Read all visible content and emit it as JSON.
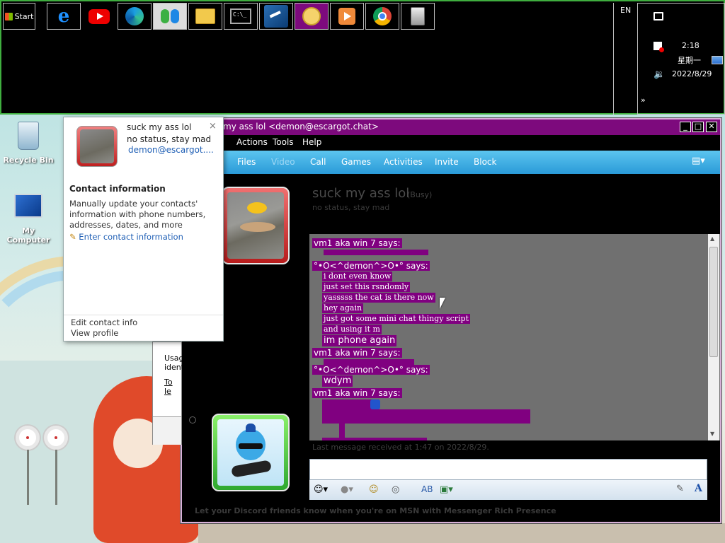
{
  "taskbar": {
    "start_label": "Start",
    "language": "EN",
    "clock": {
      "time": "2:18",
      "weekday": "星期一",
      "date": "2022/8/29"
    },
    "apps": [
      {
        "name": "internet-explorer-icon"
      },
      {
        "name": "youtube-icon"
      },
      {
        "name": "edge-icon"
      },
      {
        "name": "msn-messenger-icon"
      },
      {
        "name": "file-explorer-icon"
      },
      {
        "name": "command-prompt-icon"
      },
      {
        "name": "windows-live-mail-icon"
      },
      {
        "name": "bonzi-helper-icon"
      },
      {
        "name": "media-player-icon"
      },
      {
        "name": "chrome-icon"
      },
      {
        "name": "recycle-app-icon"
      }
    ]
  },
  "desktop": {
    "icons": [
      {
        "label": "Recycle Bin"
      },
      {
        "label": "My Computer"
      }
    ]
  },
  "messenger": {
    "title": "my ass lol <demon@escargot.chat>",
    "menu": [
      "Actions",
      "Tools",
      "Help"
    ],
    "toolbar": [
      "Files",
      "Video",
      "Call",
      "Games",
      "Activities",
      "Invite",
      "Block"
    ],
    "contact_name": "suck my ass lol",
    "contact_status": "(Busy)",
    "contact_message": "no status, stay mad",
    "messages": [
      {
        "text": "vm1 aka win 7 says:",
        "style": "sender"
      },
      {
        "text": "°•O<^demon^>O•° says:",
        "style": "sender"
      },
      {
        "text": "i dont even know",
        "style": "serif"
      },
      {
        "text": "just set this rsndomly",
        "style": "serif"
      },
      {
        "text": "yasssss the cat is there now",
        "style": "serif"
      },
      {
        "text": "hey again",
        "style": "serif"
      },
      {
        "text": "just got some mini chat thingy script",
        "style": "serif"
      },
      {
        "text": "and using it m",
        "style": "serif"
      },
      {
        "text": "im phone again",
        "style": "big"
      },
      {
        "text": "vm1 aka win 7 says:",
        "style": "sender"
      },
      {
        "text": "°•O<^demon^>O•° says:",
        "style": "sender"
      },
      {
        "text": "wdym",
        "style": "big"
      },
      {
        "text": "vm1 aka win 7 says:",
        "style": "sender"
      }
    ],
    "last_message": "Last message received at 1:47 on 2022/8/29.",
    "ad_text": "Let your Discord friends know when you're on MSN with Messenger Rich Presence",
    "colors": {
      "title": "#7d0a7d",
      "message_bg": "#800080",
      "toolbar": "#2a9ad8"
    }
  },
  "contact_card": {
    "name": "suck my ass lol",
    "status": "no status, stay mad",
    "email": "demon@escargot....",
    "section_title": "Contact information",
    "description": "Manually update your contacts' information with phone numbers, addresses, dates, and more",
    "enter_link": "Enter contact information",
    "edit_link": "Edit contact info",
    "view_link": "View profile"
  },
  "behind_window": {
    "line1": "Usag",
    "line2": "ident",
    "link": "To le"
  }
}
